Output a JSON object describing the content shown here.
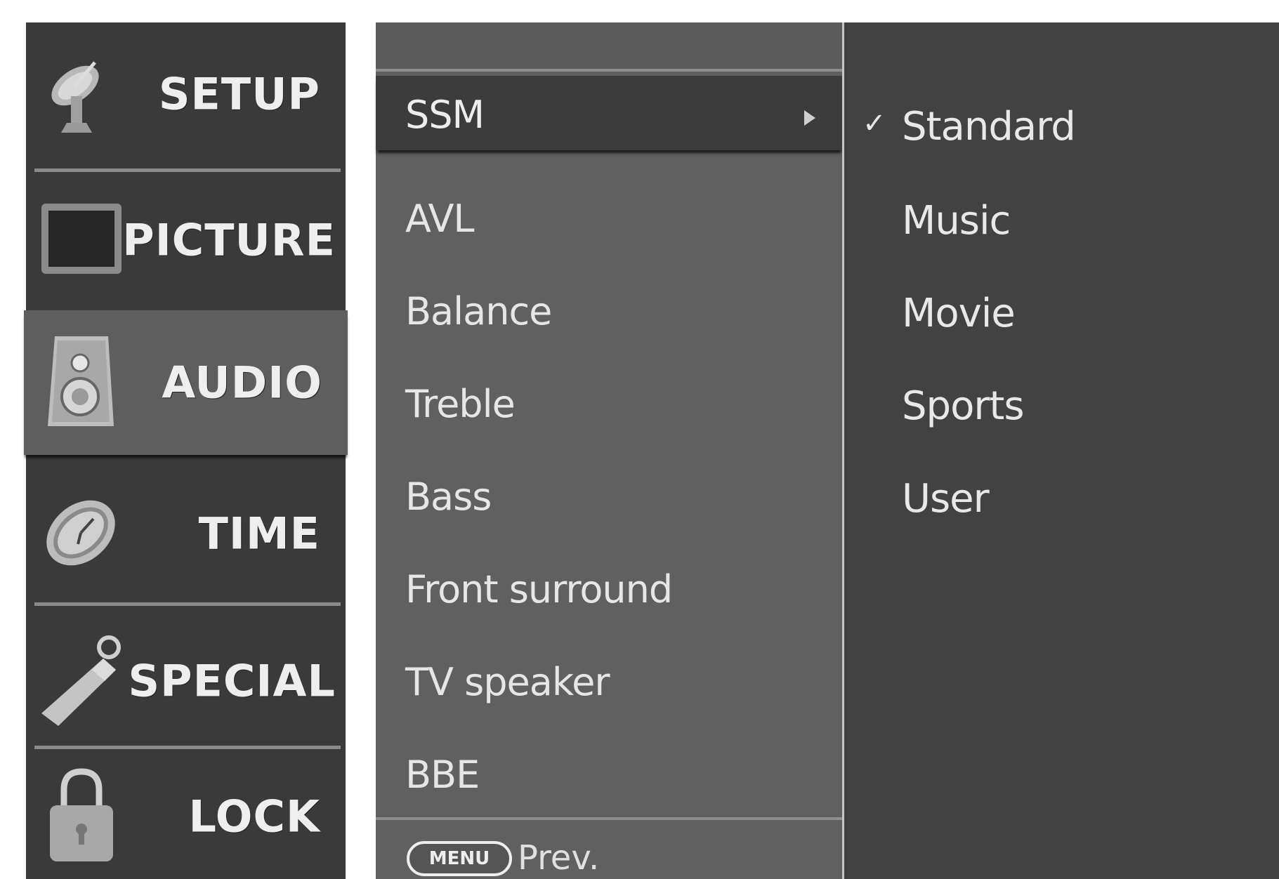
{
  "categories": [
    {
      "id": "setup",
      "label": "SETUP",
      "icon": "satellite-dish-icon"
    },
    {
      "id": "picture",
      "label": "PICTURE",
      "icon": "monitor-icon"
    },
    {
      "id": "audio",
      "label": "AUDIO",
      "icon": "speaker-icon",
      "selected": true
    },
    {
      "id": "time",
      "label": "TIME",
      "icon": "clock-icon"
    },
    {
      "id": "special",
      "label": "SPECIAL",
      "icon": "key-tag-icon"
    },
    {
      "id": "lock",
      "label": "LOCK",
      "icon": "padlock-icon"
    }
  ],
  "menu": {
    "items": [
      {
        "label": "SSM",
        "selected": true,
        "has_submenu": true
      },
      {
        "label": "AVL"
      },
      {
        "label": "Balance"
      },
      {
        "label": "Treble"
      },
      {
        "label": "Bass"
      },
      {
        "label": "Front surround"
      },
      {
        "label": "TV speaker"
      },
      {
        "label": "BBE"
      }
    ],
    "footer": {
      "button_label": "MENU",
      "action_label": "Prev."
    }
  },
  "submenu": {
    "items": [
      {
        "label": "Standard",
        "checked": true
      },
      {
        "label": "Music"
      },
      {
        "label": "Movie"
      },
      {
        "label": "Sports"
      },
      {
        "label": "User"
      }
    ]
  },
  "colors": {
    "panel_dark": "#3a3a3a",
    "panel_mid": "#606060",
    "panel_sub": "#424242",
    "highlight": "#5e5e5e",
    "text": "#e6e6e6"
  }
}
